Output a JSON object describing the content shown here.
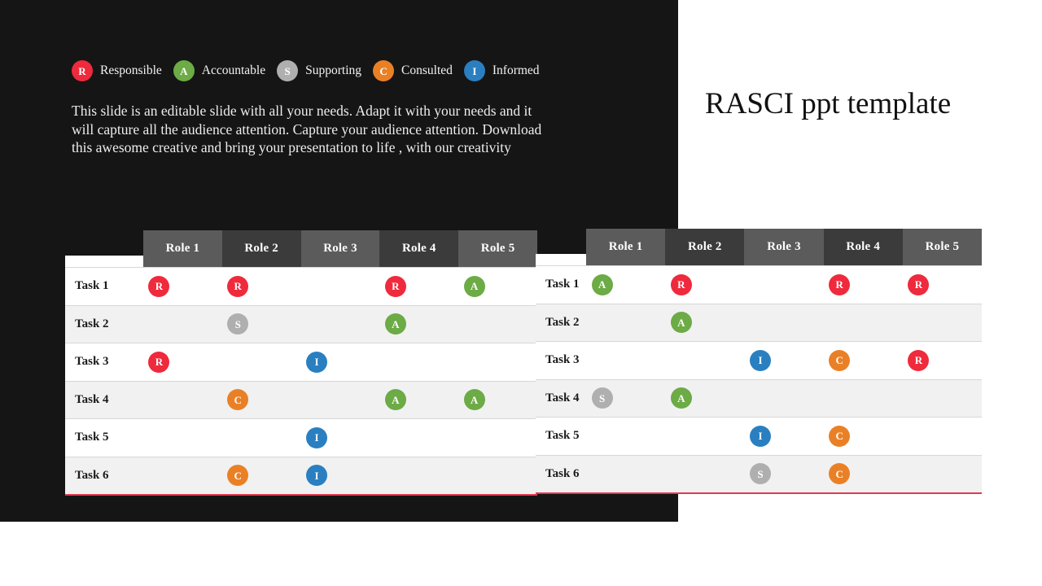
{
  "slide": {
    "title": "RASCI ppt template",
    "body_text": "This slide is an editable slide with all your needs. Adapt it with your needs and it will capture all the audience attention. Capture your audience attention. Download this awesome creative and bring your presentation to life , with our creativity"
  },
  "colors": {
    "panel_background": "#151515",
    "slide_background": "#ffffff",
    "responsible": "#ee2a3c",
    "accountable": "#6cab45",
    "supporting": "#afafaf",
    "consulted": "#ea8026",
    "informed": "#2a7fc0",
    "header_shade_light": "#5b5b5b",
    "header_shade_dark": "#3b3b3b",
    "row_alt": "#f1f1f1",
    "accent_rule": "#e03a50"
  },
  "legend": {
    "items": [
      {
        "code": "R",
        "label": "Responsible",
        "color": "#ee2a3c"
      },
      {
        "code": "A",
        "label": "Accountable",
        "color": "#6cab45"
      },
      {
        "code": "S",
        "label": "Supporting",
        "color": "#afafaf"
      },
      {
        "code": "C",
        "label": "Consulted",
        "color": "#ea8026"
      },
      {
        "code": "I",
        "label": "Informed",
        "color": "#2a7fc0"
      }
    ]
  },
  "matrix_left": {
    "columns": [
      "Role 1",
      "Role 2",
      "Role 3",
      "Role 4",
      "Role 5"
    ],
    "rows": [
      {
        "task": "Task 1",
        "cells": [
          "R",
          "R",
          "",
          "R",
          "A"
        ]
      },
      {
        "task": "Task 2",
        "cells": [
          "",
          "S",
          "",
          "A",
          ""
        ]
      },
      {
        "task": "Task 3",
        "cells": [
          "R",
          "",
          "I",
          "",
          ""
        ]
      },
      {
        "task": "Task 4",
        "cells": [
          "",
          "C",
          "",
          "A",
          "A"
        ]
      },
      {
        "task": "Task 5",
        "cells": [
          "",
          "",
          "I",
          "",
          ""
        ]
      },
      {
        "task": "Task 6",
        "cells": [
          "",
          "C",
          "I",
          "",
          ""
        ]
      }
    ]
  },
  "matrix_right": {
    "columns": [
      "Role 1",
      "Role 2",
      "Role 3",
      "Role 4",
      "Role 5"
    ],
    "rows": [
      {
        "task": "Task 1",
        "cells": [
          "A",
          "R",
          "",
          "R",
          "R"
        ]
      },
      {
        "task": "Task 2",
        "cells": [
          "",
          "A",
          "",
          "",
          ""
        ]
      },
      {
        "task": "Task 3",
        "cells": [
          "",
          "",
          "I",
          "C",
          "R"
        ]
      },
      {
        "task": "Task 4",
        "cells": [
          "S",
          "A",
          "",
          "",
          ""
        ]
      },
      {
        "task": "Task 5",
        "cells": [
          "",
          "",
          "I",
          "C",
          ""
        ]
      },
      {
        "task": "Task 6",
        "cells": [
          "",
          "",
          "S",
          "C",
          ""
        ]
      }
    ]
  }
}
